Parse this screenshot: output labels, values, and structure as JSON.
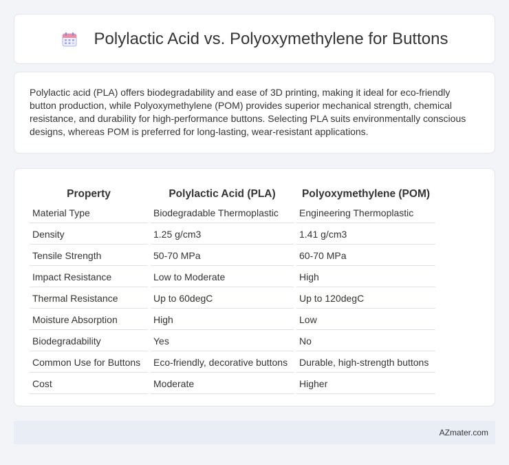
{
  "header": {
    "title": "Polylactic Acid vs. Polyoxymethylene for Buttons",
    "icon": "calendar-icon"
  },
  "summary": {
    "text": "Polylactic acid (PLA) offers biodegradability and ease of 3D printing, making it ideal for eco-friendly button production, while Polyoxymethylene (POM) provides superior mechanical strength, chemical resistance, and durability for high-performance buttons. Selecting PLA suits environmentally conscious designs, whereas POM is preferred for long-lasting, wear-resistant applications."
  },
  "table": {
    "headers": [
      "Property",
      "Polylactic Acid (PLA)",
      "Polyoxymethylene (POM)"
    ],
    "rows": [
      [
        "Material Type",
        "Biodegradable Thermoplastic",
        "Engineering Thermoplastic"
      ],
      [
        "Density",
        "1.25 g/cm3",
        "1.41 g/cm3"
      ],
      [
        "Tensile Strength",
        "50-70 MPa",
        "60-70 MPa"
      ],
      [
        "Impact Resistance",
        "Low to Moderate",
        "High"
      ],
      [
        "Thermal Resistance",
        "Up to 60degC",
        "Up to 120degC"
      ],
      [
        "Moisture Absorption",
        "High",
        "Low"
      ],
      [
        "Biodegradability",
        "Yes",
        "No"
      ],
      [
        "Common Use for Buttons",
        "Eco-friendly, decorative buttons",
        "Durable, high-strength buttons"
      ],
      [
        "Cost",
        "Moderate",
        "Higher"
      ]
    ]
  },
  "footer": {
    "text": "AZmater.com"
  },
  "colors": {
    "background": "#f3f4f8",
    "card": "#ffffff",
    "footer": "#e9edf6",
    "icon_accent": "#8b7fd6"
  }
}
